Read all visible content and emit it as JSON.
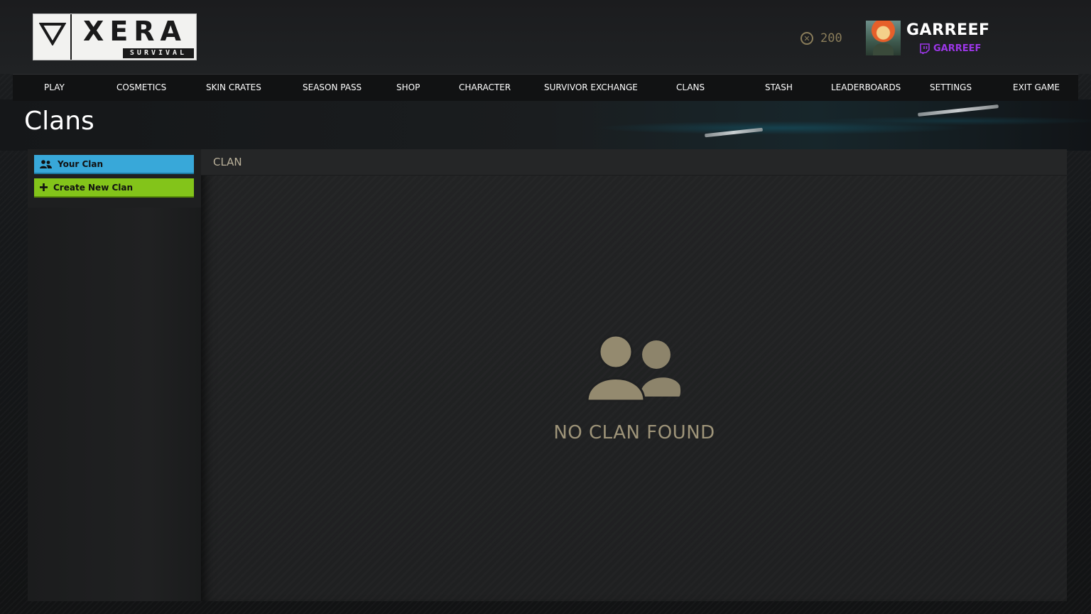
{
  "logo": {
    "name": "XERA",
    "subtitle": "SURVIVAL"
  },
  "header": {
    "currency_value": "200",
    "username": "GARREEF",
    "twitch_name": "GARREEF"
  },
  "nav": {
    "items": [
      {
        "label": "PLAY"
      },
      {
        "label": "COSMETICS"
      },
      {
        "label": "SKIN CRATES"
      },
      {
        "label": "SEASON PASS"
      },
      {
        "label": "SHOP"
      },
      {
        "label": "CHARACTER"
      },
      {
        "label": "SURVIVOR EXCHANGE"
      },
      {
        "label": "CLANS"
      },
      {
        "label": "STASH"
      },
      {
        "label": "LEADERBOARDS"
      },
      {
        "label": "SETTINGS"
      },
      {
        "label": "EXIT GAME"
      }
    ]
  },
  "page": {
    "title": "Clans"
  },
  "sidebar": {
    "your_clan_label": "Your Clan",
    "create_clan_label": "Create New Clan"
  },
  "main": {
    "header_label": "CLAN",
    "empty_message": "NO CLAN FOUND"
  },
  "colors": {
    "your_clan_button": "#38a8d9",
    "create_clan_button": "#83c41a",
    "twitch": "#9b36e6",
    "muted_gold": "#9e9479"
  },
  "icons": {
    "currency": "x-coin-icon",
    "twitch": "twitch-icon",
    "your_clan": "users-icon",
    "create_clan": "plus-icon",
    "empty_state": "people-icon"
  }
}
